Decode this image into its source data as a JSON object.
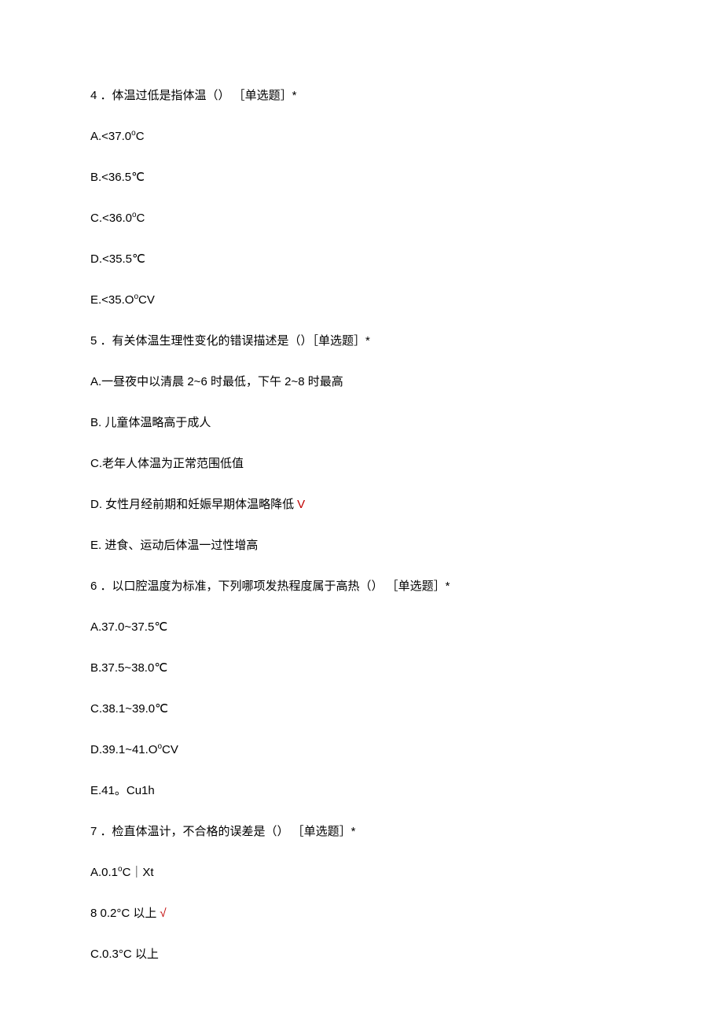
{
  "questions": [
    {
      "number": "4",
      "text": "．体温过低是指体温（） ［单选题］*",
      "options": [
        {
          "text": "A.<37.0",
          "suffix": "C",
          "sup": "o",
          "correct": false
        },
        {
          "text": "B.<36.5℃",
          "suffix": "",
          "sup": "",
          "correct": false
        },
        {
          "text": "C.<36.0",
          "suffix": "C",
          "sup": "o",
          "correct": false
        },
        {
          "text": "D.<35.5℃",
          "suffix": "",
          "sup": "",
          "correct": false
        },
        {
          "text": "E.<35.O",
          "suffix": "CV",
          "sup": "o",
          "correct": false
        }
      ]
    },
    {
      "number": "5",
      "text": "．有关体温生理性变化的错误描述是（）［单选题］*",
      "options": [
        {
          "text": "A.一昼夜中以清晨 2~6 时最低，下午 2~8 时最高",
          "suffix": "",
          "sup": "",
          "correct": false
        },
        {
          "text": "B. 儿童体温略高于成人",
          "suffix": "",
          "sup": "",
          "correct": false
        },
        {
          "text": "C.老年人体温为正常范围低值",
          "suffix": "",
          "sup": "",
          "correct": false
        },
        {
          "text": "D. 女性月经前期和妊娠早期体温略降低",
          "suffix": "",
          "sup": "",
          "correct": true,
          "mark": "V"
        },
        {
          "text": "E. 进食、运动后体温一过性增高",
          "suffix": "",
          "sup": "",
          "correct": false
        }
      ]
    },
    {
      "number": "6",
      "text": "．以口腔温度为标准，下列哪项发热程度属于高热（） ［单选题］*",
      "options": [
        {
          "text": "A.37.0~37.5℃",
          "suffix": "",
          "sup": "",
          "correct": false
        },
        {
          "text": "B.37.5~38.0℃",
          "suffix": "",
          "sup": "",
          "correct": false
        },
        {
          "text": "C.38.1~39.0℃",
          "suffix": "",
          "sup": "",
          "correct": false
        },
        {
          "text": "D.39.1~41.O",
          "suffix": "CV",
          "sup": "o",
          "correct": false
        },
        {
          "text": "E.41。Cu1h",
          "suffix": "",
          "sup": "",
          "correct": false
        }
      ]
    },
    {
      "number": "7",
      "text": "．检直体温计，不合格的误差是（） ［单选题］*",
      "options": [
        {
          "text": "A.0.1",
          "suffix": "C｜Xt",
          "sup": "o",
          "correct": false
        },
        {
          "text": "8   0.2°C 以上",
          "suffix": "",
          "sup": "",
          "correct": true,
          "mark": "√"
        },
        {
          "text": "C.0.3°C 以上",
          "suffix": "",
          "sup": "",
          "correct": false
        }
      ]
    }
  ]
}
